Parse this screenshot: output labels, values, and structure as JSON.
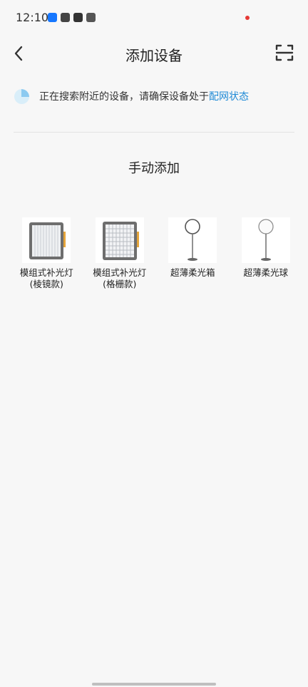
{
  "status_bar": {
    "time": "12:10"
  },
  "nav": {
    "title": "添加设备"
  },
  "searching": {
    "text": "正在搜索附近的设备，请确保设备处于",
    "link": "配网状态"
  },
  "section": {
    "title": "手动添加"
  },
  "devices": [
    {
      "name_line1": "模组式补光灯",
      "name_line2": "(棱镜款)",
      "icon": "panel-light-prism-icon"
    },
    {
      "name_line1": "模组式补光灯",
      "name_line2": "(格栅款)",
      "icon": "panel-light-grid-icon"
    },
    {
      "name_line1": "超薄柔光箱",
      "name_line2": "",
      "icon": "ring-softbox-stand-icon"
    },
    {
      "name_line1": "超薄柔光球",
      "name_line2": "",
      "icon": "ball-light-stand-icon"
    }
  ],
  "colors": {
    "accent": "#1f8ad6",
    "background": "#f7f7f7"
  }
}
